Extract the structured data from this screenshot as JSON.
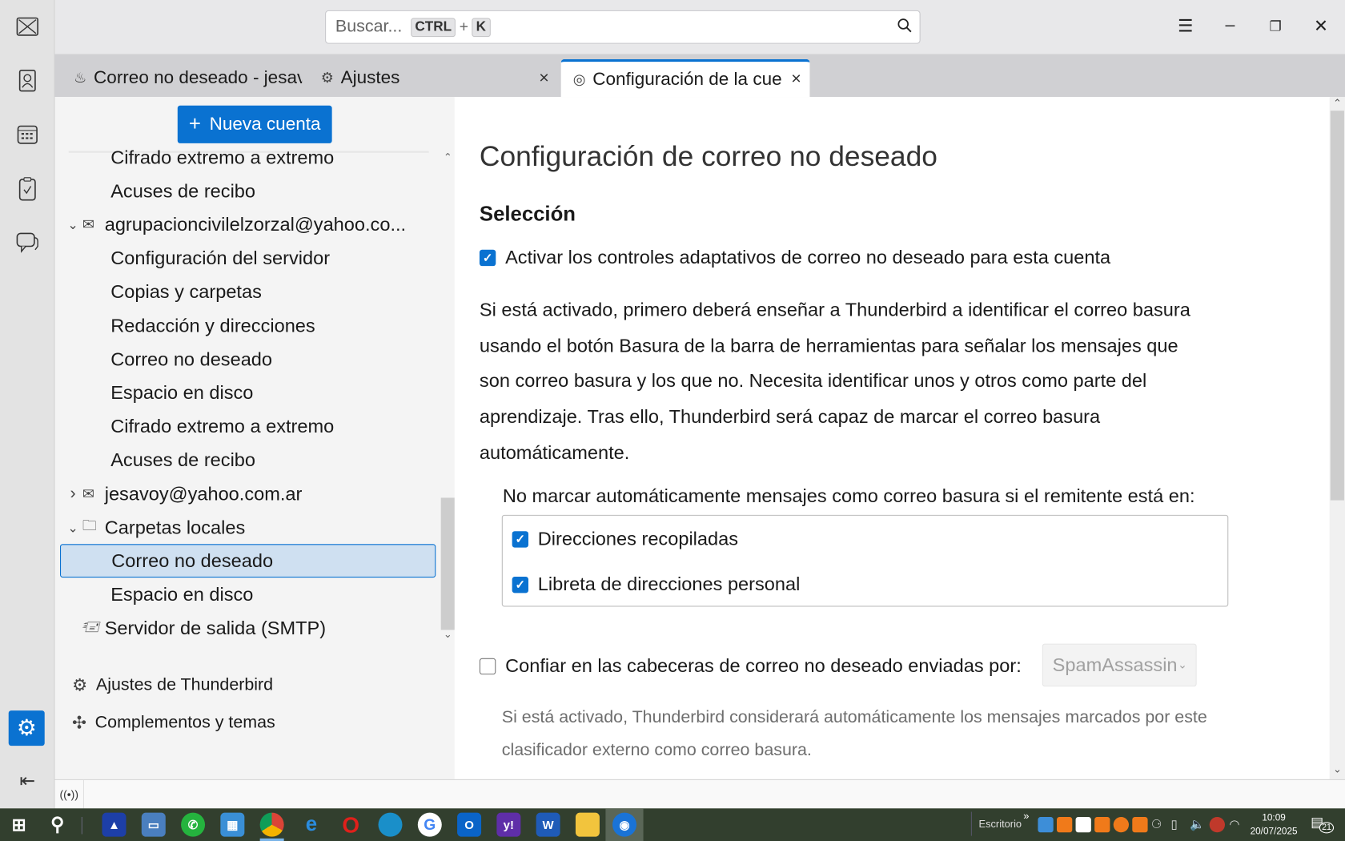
{
  "spaces": {
    "items": [
      "mail",
      "address-book",
      "calendar",
      "tasks",
      "chat",
      "settings",
      "collapse"
    ]
  },
  "search": {
    "placeholder": "Buscar...",
    "shortcut_key1": "CTRL",
    "shortcut_plus": "+",
    "shortcut_key2": "K"
  },
  "tabs": [
    {
      "label": "Correo no deseado - jesav",
      "icon": "junk-icon"
    },
    {
      "label": "Ajustes",
      "icon": "gear-icon",
      "close": "×"
    },
    {
      "label": "Configuración de la cue",
      "icon": "account-icon",
      "close": "×",
      "active": true
    }
  ],
  "leftpane": {
    "new_account": "Nueva cuenta",
    "new_account_icon": "+",
    "tree": [
      {
        "label": "Cifrado extremo a extremo",
        "level": 1
      },
      {
        "label": "Acuses de recibo",
        "level": 1
      },
      {
        "label": "agrupacioncivilelzorzal@yahoo.co...",
        "level": 0,
        "expanded": true
      },
      {
        "label": "Configuración del servidor",
        "level": 1
      },
      {
        "label": "Copias y carpetas",
        "level": 1
      },
      {
        "label": "Redacción y direcciones",
        "level": 1
      },
      {
        "label": "Correo no deseado",
        "level": 1
      },
      {
        "label": "Espacio en disco",
        "level": 1
      },
      {
        "label": "Cifrado extremo a extremo",
        "level": 1
      },
      {
        "label": "Acuses de recibo",
        "level": 1
      },
      {
        "label": "jesavoy@yahoo.com.ar",
        "level": 0,
        "expanded": false
      },
      {
        "label": "Carpetas locales",
        "level": 0,
        "expanded": true
      },
      {
        "label": "Correo no deseado",
        "level": 1,
        "selected": true
      },
      {
        "label": "Espacio en disco",
        "level": 1
      },
      {
        "label": "Servidor de salida (SMTP)",
        "level": 0
      }
    ],
    "settings_link": "Ajustes de Thunderbird",
    "addons_link": "Complementos y temas"
  },
  "main": {
    "title": "Configuración de correo no deseado",
    "section": "Selección",
    "adaptive_label": "Activar los controles adaptativos de correo no deseado para esta cuenta",
    "adaptive_checked": true,
    "description_lines": [
      "Si está activado, primero deberá enseñar a Thunderbird a identificar el correo basura",
      "usando el botón Basura de la barra de herramientas para señalar los mensajes que",
      "son correo basura y los que no. Necesita identificar unos y otros como parte del",
      "aprendizaje. Tras ello, Thunderbird será capaz de marcar el correo basura",
      "automáticamente."
    ],
    "whitelist_label": "No marcar automáticamente mensajes como correo basura si el remitente está en:",
    "whitelist": [
      {
        "label": "Direcciones recopiladas",
        "checked": true
      },
      {
        "label": "Libreta de direcciones personal",
        "checked": true
      }
    ],
    "trust_label": "Confiar en las cabeceras de correo no deseado enviadas por:",
    "trust_checked": false,
    "trust_select": "SpamAssassin",
    "trust_help_lines": [
      "Si está activado, Thunderbird considerará automáticamente los mensajes marcados por este",
      "clasificador externo como correo basura."
    ]
  },
  "taskbar": {
    "desktop_label": "Escritorio",
    "overflow": "»",
    "time": "10:09",
    "date": "20/07/2025",
    "notifications": "21",
    "apps": [
      "scanner",
      "computer",
      "whatsapp",
      "control-panel",
      "chrome",
      "internet-explorer",
      "opera",
      "edge",
      "google",
      "outlook",
      "yahoo",
      "word",
      "file-explorer",
      "thunderbird"
    ]
  },
  "colors": {
    "accent": "#0a72d1",
    "taskbar": "#323f2e",
    "selection": "#cfe0f1"
  }
}
